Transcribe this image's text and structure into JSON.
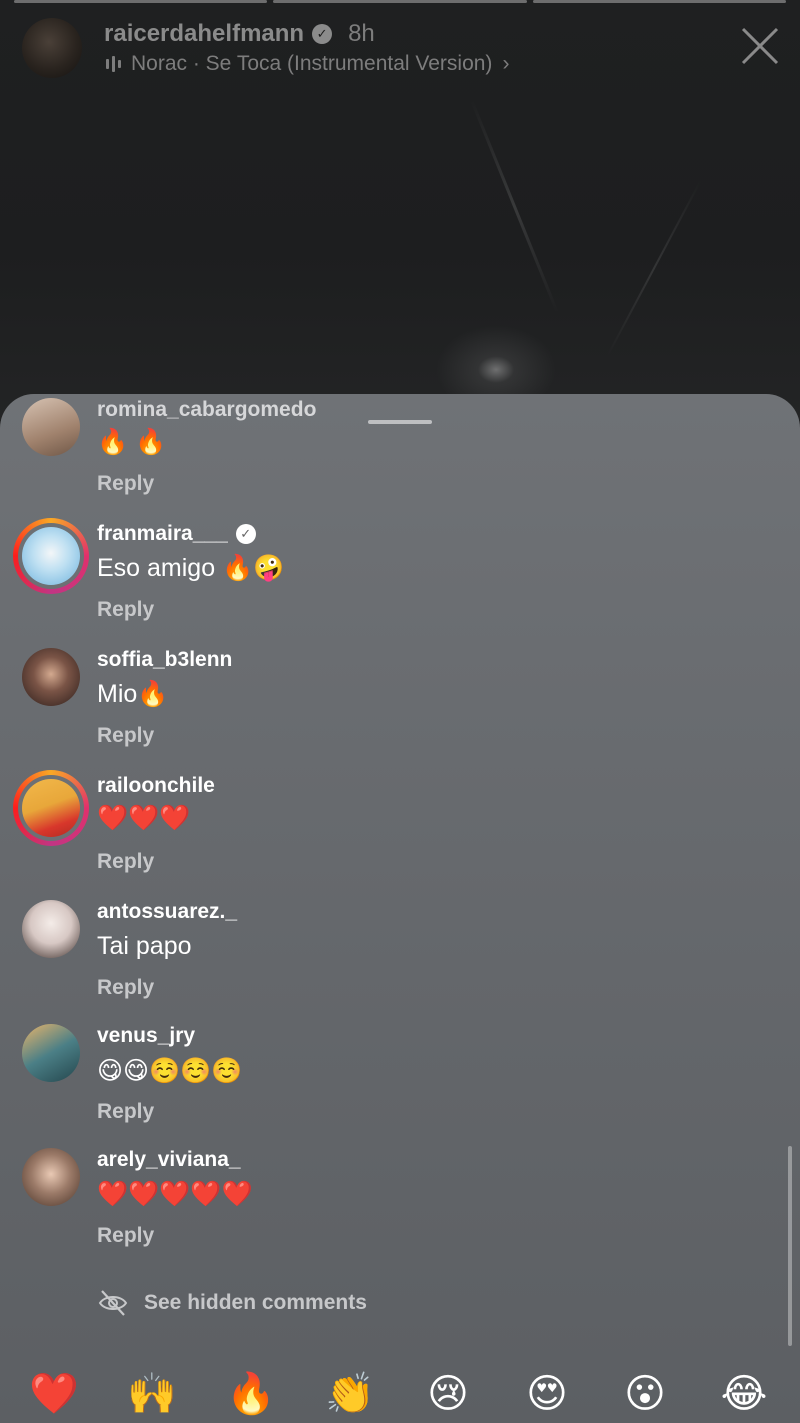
{
  "story": {
    "username": "raicerdahelfmann",
    "time": "8h",
    "music": "Norac · Se Toca (Instrumental Version)",
    "music_chevron": "›"
  },
  "comments": [
    {
      "username": "romina_cabargomedo",
      "text": "🔥 🔥",
      "reply": "Reply",
      "verified": false,
      "ring": false,
      "avatar_color": "#a0826d"
    },
    {
      "username": "franmaira___",
      "text": "Eso amigo 🔥🤪",
      "reply": "Reply",
      "verified": true,
      "ring": true,
      "avatar_color": "#8ec5e6"
    },
    {
      "username": "soffia_b3lenn",
      "text": "Mio🔥",
      "reply": "Reply",
      "verified": false,
      "ring": false,
      "avatar_color": "#3b2a25"
    },
    {
      "username": "railoonchile",
      "text": "❤️❤️❤️",
      "reply": "Reply",
      "verified": false,
      "ring": true,
      "avatar_color": "#e8a73a"
    },
    {
      "username": "antossuarez._",
      "text": "Tai papo",
      "reply": "Reply",
      "verified": false,
      "ring": false,
      "avatar_color": "#d7c8c4"
    },
    {
      "username": "venus_jry",
      "text": "😋😋☺️☺️☺️",
      "reply": "Reply",
      "verified": false,
      "ring": false,
      "avatar_color": "#4b7f86"
    },
    {
      "username": "arely_viviana_",
      "text": "❤️❤️❤️❤️❤️",
      "reply": "Reply",
      "verified": false,
      "ring": false,
      "avatar_color": "#9b7a68"
    }
  ],
  "hidden_comments": {
    "label": "See hidden comments",
    "icon": "eye-slash-icon"
  },
  "quick_reactions": [
    "❤️",
    "🙌",
    "🔥",
    "👏",
    "😢",
    "😍",
    "😮",
    "😂"
  ]
}
